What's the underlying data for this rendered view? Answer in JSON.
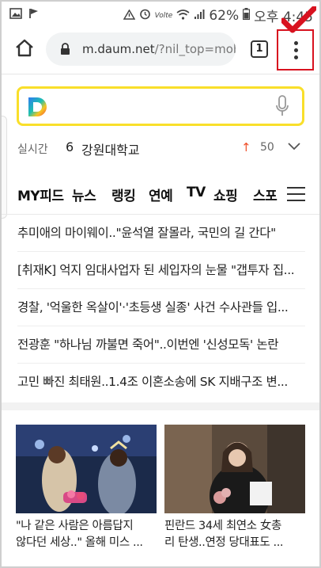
{
  "status_bar": {
    "battery": "62%",
    "time": "오후 4:45",
    "signal_label": "Volte"
  },
  "browser": {
    "url_host": "m.daum.net",
    "url_path": "/?nil_top=mobile",
    "tab_count": "1"
  },
  "search": {
    "realtime_label": "실시간",
    "realtime_rank": "6",
    "realtime_term": "강원대학교",
    "realtime_change": "50"
  },
  "nav": {
    "tabs": [
      "MY피드",
      "뉴스",
      "랭킹",
      "연예",
      "TV",
      "쇼핑",
      "스포"
    ]
  },
  "news": [
    "추미애의 마이웨이..\"윤석열 잘몰라, 국민의 길 간다\"",
    "[취재K] 억지 임대사업자 된 세입자의 눈물 \"갭투자 집...",
    "경찰, '억울한 옥살이'·'초등생 실종' 사건 수사관들 입...",
    "전광훈 \"하나님 까불면 죽어\"..이번엔 '신성모독' 논란",
    "고민 빠진 최태원..1.4조 이혼소송에 SK 지배구조 변..."
  ],
  "cards": [
    {
      "line1": "\"나 같은 사람은 아름답지",
      "line2": "않다던 세상..\" 올해 미스 ..."
    },
    {
      "line1": "핀란드 34세 최연소 女총",
      "line2": "리 탄생..연정 당대표도 ..."
    }
  ],
  "colors": {
    "search_border": "#f9df2a",
    "highlight_red": "#d8121f",
    "rank_up": "#f0512c"
  }
}
